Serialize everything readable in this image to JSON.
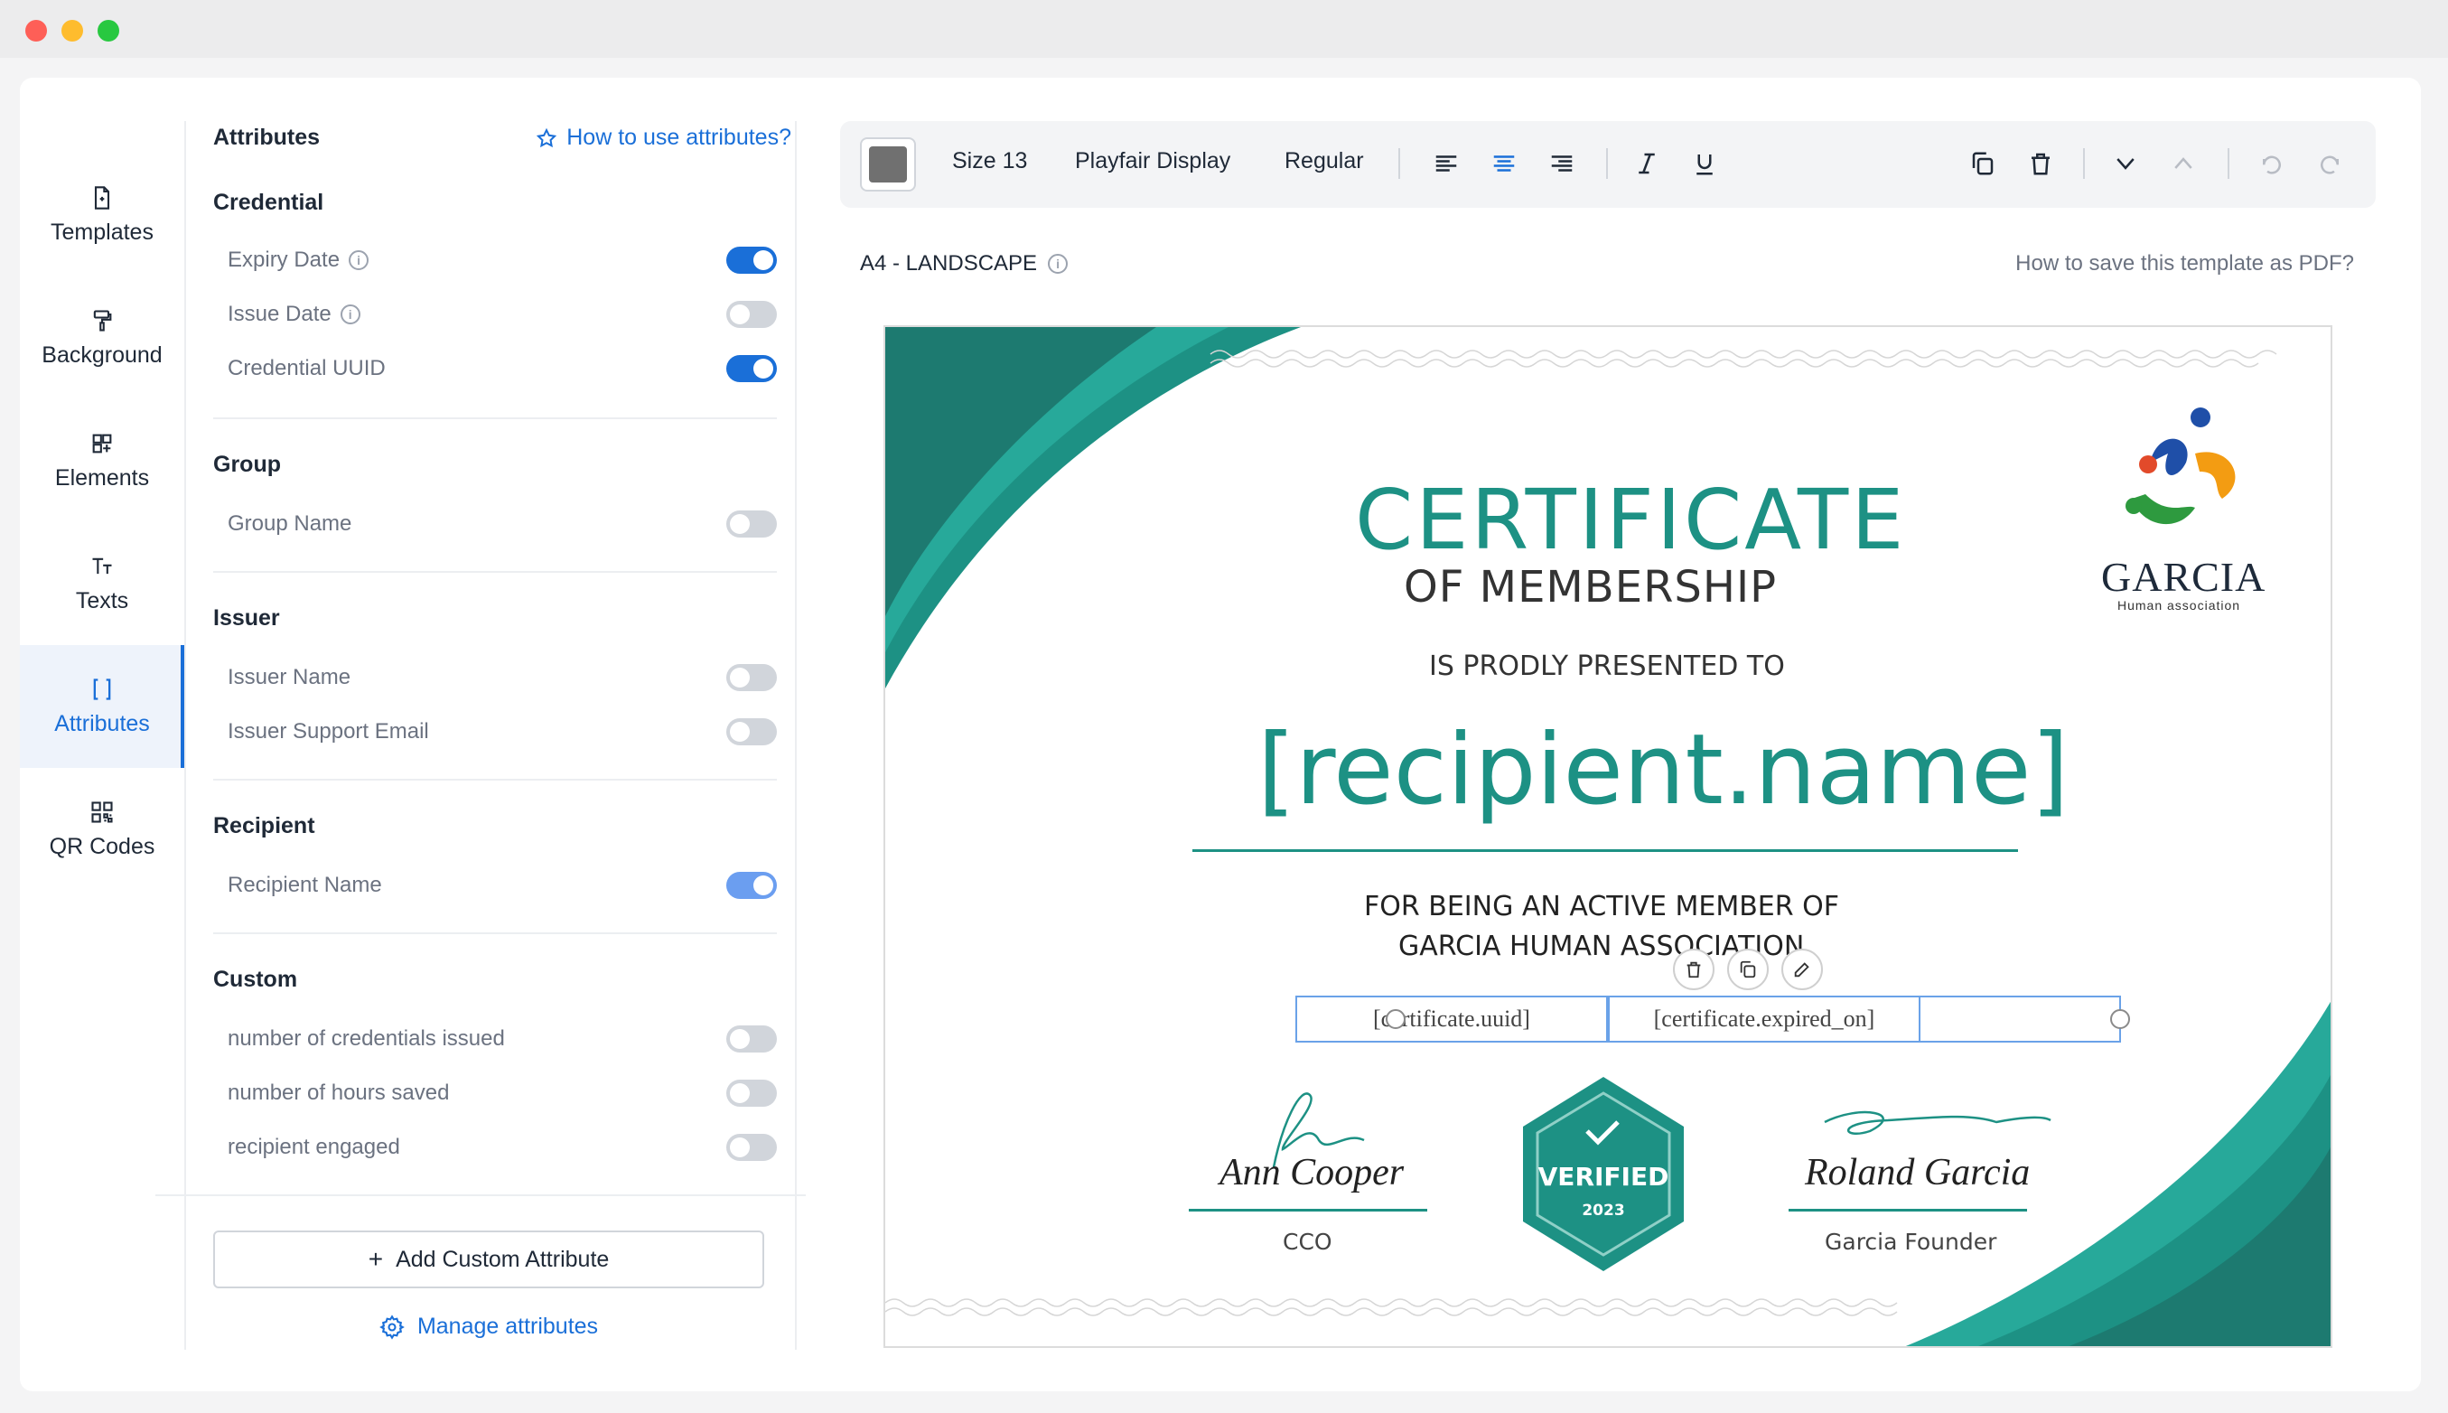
{
  "nav": {
    "items": [
      {
        "label": "Templates",
        "icon": "file-icon"
      },
      {
        "label": "Background",
        "icon": "paint-roller-icon"
      },
      {
        "label": "Elements",
        "icon": "elements-icon"
      },
      {
        "label": "Texts",
        "icon": "text-size-icon"
      },
      {
        "label": "Attributes",
        "icon": "brackets-icon"
      },
      {
        "label": "QR Codes",
        "icon": "qr-code-icon"
      }
    ],
    "active": "Attributes"
  },
  "attributes_panel": {
    "title": "Attributes",
    "help_link": "How to use attributes?",
    "sections": [
      {
        "title": "Credential",
        "rows": [
          {
            "label": "Expiry Date",
            "info": true,
            "enabled": true
          },
          {
            "label": "Issue Date",
            "info": true,
            "enabled": false
          },
          {
            "label": "Credential UUID",
            "info": false,
            "enabled": true
          }
        ]
      },
      {
        "title": "Group",
        "rows": [
          {
            "label": "Group Name",
            "info": false,
            "enabled": false
          }
        ]
      },
      {
        "title": "Issuer",
        "rows": [
          {
            "label": "Issuer Name",
            "info": false,
            "enabled": false
          },
          {
            "label": "Issuer Support Email",
            "info": false,
            "enabled": false
          }
        ]
      },
      {
        "title": "Recipient",
        "rows": [
          {
            "label": "Recipient Name",
            "info": false,
            "enabled": true
          }
        ]
      },
      {
        "title": "Custom",
        "rows": [
          {
            "label": "number of credentials issued",
            "info": false,
            "enabled": false
          },
          {
            "label": "number of hours saved",
            "info": false,
            "enabled": false
          },
          {
            "label": "recipient engaged",
            "info": false,
            "enabled": false
          }
        ]
      }
    ],
    "add_button": "Add Custom Attribute",
    "manage_link": "Manage attributes"
  },
  "toolbar": {
    "color": "#707070",
    "size": "Size 13",
    "font": "Playfair Display",
    "weight": "Regular",
    "alignment": "center"
  },
  "canvas": {
    "format": "A4 - LANDSCAPE",
    "save_pdf_link": "How to save this template as PDF?"
  },
  "certificate": {
    "title": "CERTIFICATE",
    "subtitle": "OF MEMBERSHIP",
    "presented": "IS PRODLY PRESENTED TO",
    "recipient": "[recipient.name]",
    "for_line1": "FOR BEING AN ACTIVE MEMBER OF",
    "for_line2": "GARCIA HUMAN ASSOCIATION",
    "field_uuid": "[certificate.uuid]",
    "field_expiry": "[certificate.expired_on]",
    "signer1_name": "Ann Cooper",
    "signer1_role": "CCO",
    "signer2_name": "Roland Garcia",
    "signer2_role": "Garcia Founder",
    "badge_text": "VERIFIED",
    "badge_year": "2023",
    "org_name": "GARCIA",
    "org_tagline": "Human association",
    "accent_color": "#1d9184"
  }
}
